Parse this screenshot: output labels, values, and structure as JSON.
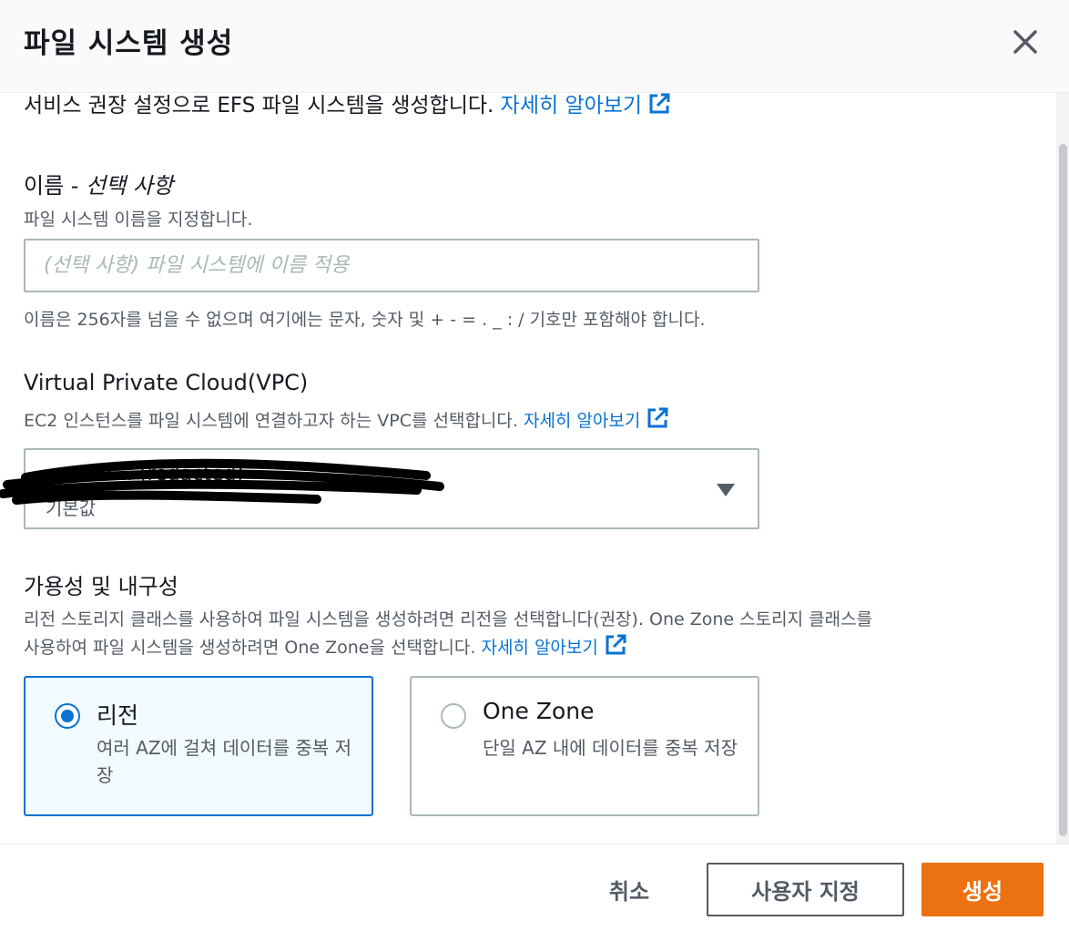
{
  "modal": {
    "title": "파일 시스템 생성"
  },
  "intro": {
    "text": "서비스 권장 설정으로 EFS 파일 시스템을 생성합니다.",
    "link": "자세히 알아보기"
  },
  "name_field": {
    "label": "이름 - ",
    "label_optional": "선택 사항",
    "description": "파일 시스템 이름을 지정합니다.",
    "placeholder": "(선택 사항) 파일 시스템에 이름 적용",
    "value": "",
    "constraint": "이름은 256자를 넘을 수 없으며 여기에는 문자, 숫자 및 + - = . _ : / 기호만 포함해야 합니다."
  },
  "vpc_field": {
    "label": "Virtual Private Cloud(VPC)",
    "description": "EC2 인스턴스를 파일 시스템에 연결하고자 하는 VPC를 선택합니다.",
    "link": "자세히 알아보기",
    "selected_value": "vpc-07... (redacted)",
    "selected_sub": "기본값"
  },
  "availability": {
    "label": "가용성 및 내구성",
    "description_line1": "리전 스토리지 클래스를 사용하여 파일 시스템을 생성하려면 리전을 선택합니다(권장). One Zone 스토리지 클래스를",
    "description_line2": "사용하여 파일 시스템을 생성하려면 One Zone을 선택합니다.",
    "link": "자세히 알아보기",
    "options": [
      {
        "title": "리전",
        "description": "여러 AZ에 걸쳐 데이터를 중복 저장",
        "selected": true
      },
      {
        "title": "One Zone",
        "description": "단일 AZ 내에 데이터를 중복 저장",
        "selected": false
      }
    ]
  },
  "footer": {
    "cancel": "취소",
    "customize": "사용자 지정",
    "create": "생성"
  },
  "colors": {
    "link": "#0972d3",
    "primary": "#ec7211",
    "selected_tile_bg": "#f1faff"
  },
  "icons": [
    "close-icon",
    "external-link-icon",
    "caret-down-icon",
    "radio-icon"
  ]
}
